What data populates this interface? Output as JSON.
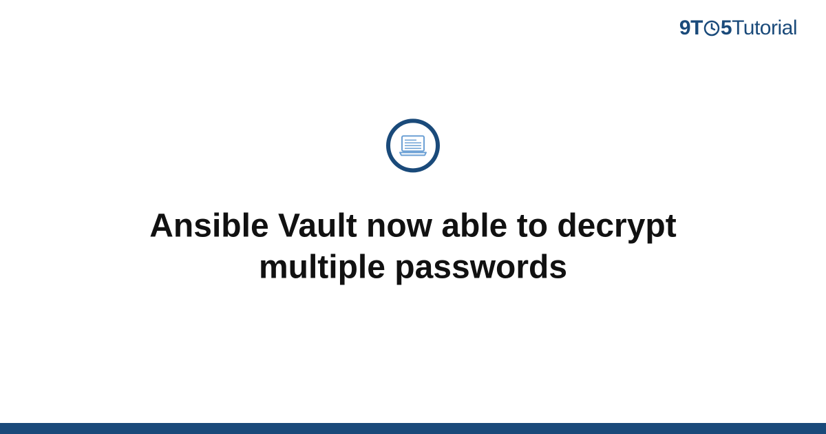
{
  "brand": {
    "prefix_nine": "9",
    "prefix_t": "T",
    "prefix_five": "5",
    "suffix": "Tutorial"
  },
  "main": {
    "title": "Ansible Vault now able to decrypt multiple passwords"
  },
  "colors": {
    "accent": "#1a4a7a",
    "icon_stroke": "#6a9fd4"
  }
}
